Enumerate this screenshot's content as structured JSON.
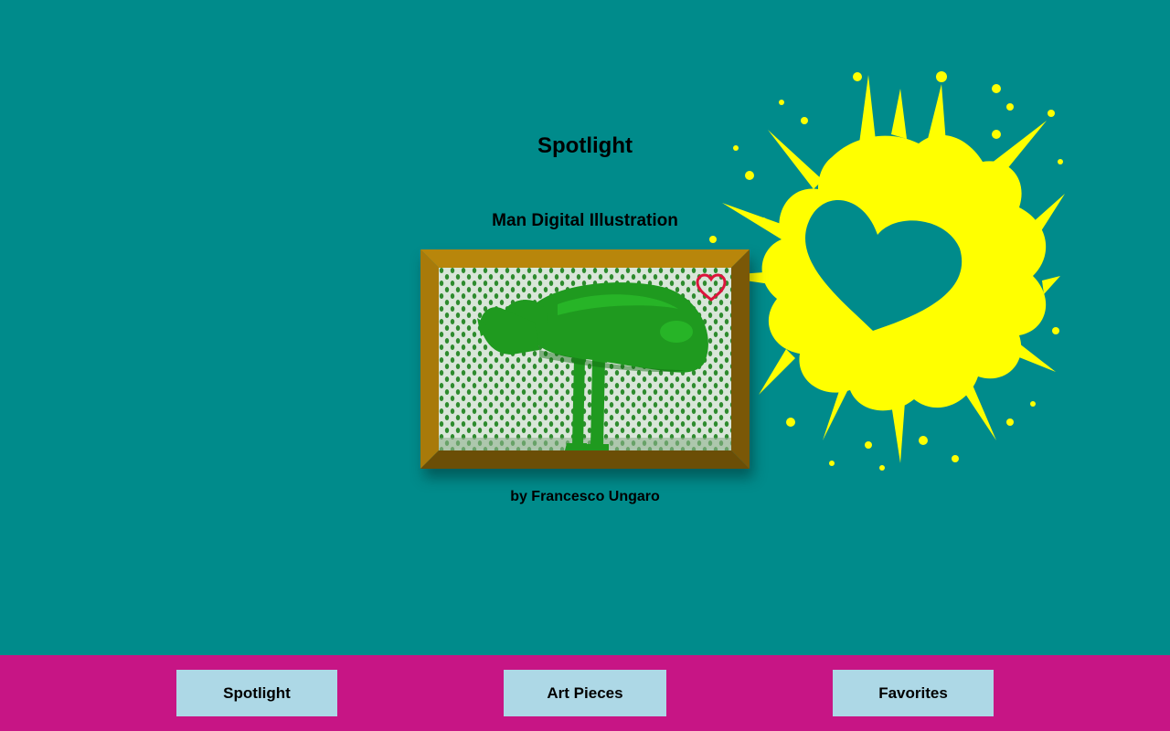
{
  "page": {
    "title": "Spotlight"
  },
  "artwork": {
    "title": "Man Digital Illustration",
    "artist": "by Francesco Ungaro",
    "favorite_icon": "heart-outline-icon",
    "favorited": false
  },
  "decoration": {
    "splash_icon": "heart-splash-icon",
    "splash_color": "#ffff00"
  },
  "nav": {
    "items": [
      {
        "label": "Spotlight"
      },
      {
        "label": "Art Pieces"
      },
      {
        "label": "Favorites"
      }
    ]
  },
  "colors": {
    "background": "#008b8b",
    "nav_background": "#c71585",
    "button_background": "#add8e6",
    "frame_gold": "#b8860b",
    "heart_outline": "#dc143c"
  }
}
